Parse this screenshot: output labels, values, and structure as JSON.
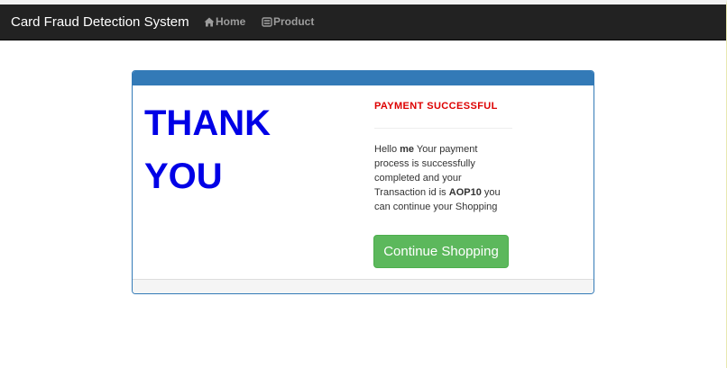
{
  "navbar": {
    "brand": "Card Fraud Detection System",
    "links": [
      {
        "label": "Home",
        "icon": "home-icon"
      },
      {
        "label": "Product",
        "icon": "product-icon"
      }
    ],
    "background_color": "#222222",
    "link_color": "#9d9d9d"
  },
  "panel": {
    "heading_color": "#337ab7",
    "thank_you_lines": [
      "THANK",
      "YOU"
    ],
    "thank_you_color": "#0000e6",
    "status_title": "PAYMENT SUCCESSFUL",
    "status_color": "#dd0000",
    "message": {
      "greeting": "Hello",
      "user_name": "me",
      "text_before_id": "Your payment process is successfully completed and your Transaction id is",
      "transaction_id": "AOP10",
      "text_after_id": "you can continue your Shopping"
    },
    "continue_button_label": "Continue Shopping",
    "continue_button_color": "#5cb85c"
  }
}
